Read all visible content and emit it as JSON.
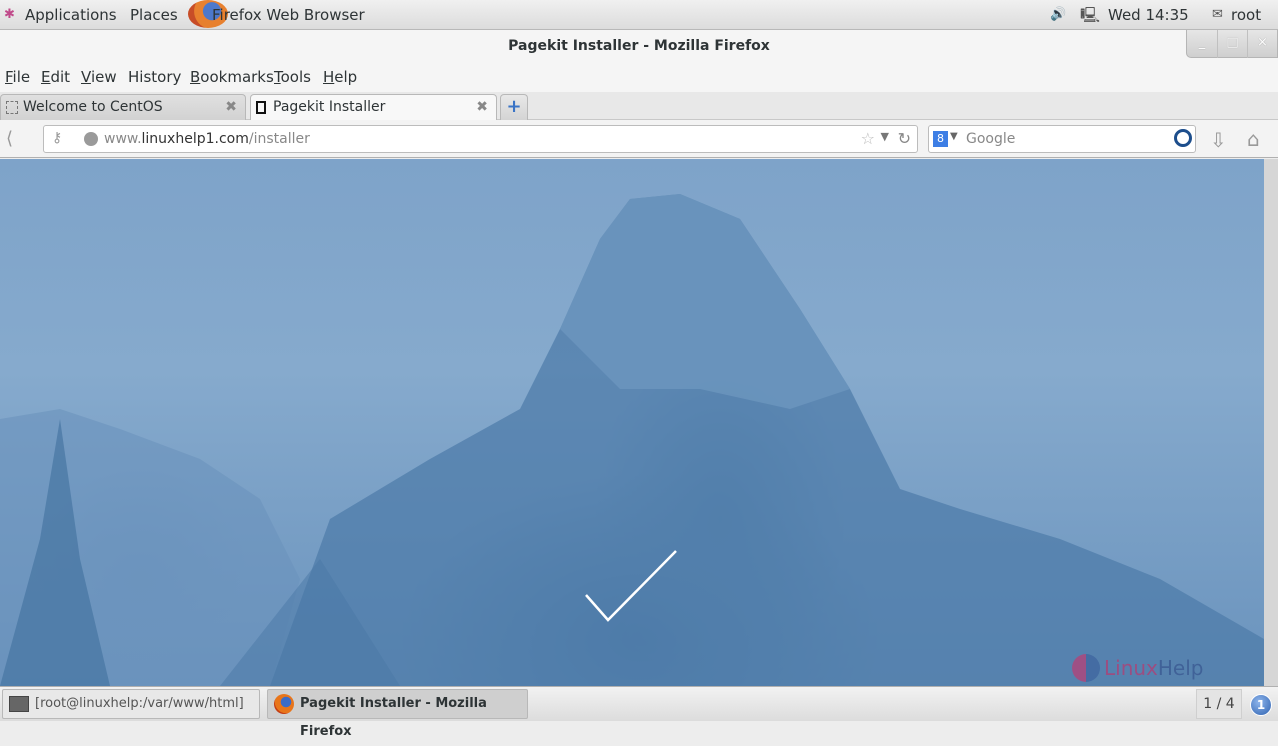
{
  "top_panel": {
    "applications": "Applications",
    "places": "Places",
    "active_app": "Firefox Web Browser",
    "clock": "Wed 14:35",
    "user": "root",
    "icons": [
      "applications-icon",
      "firefox-icon",
      "volume-icon",
      "network-icon",
      "user-icon"
    ]
  },
  "window": {
    "title": "Pagekit Installer - Mozilla Firefox",
    "controls": {
      "minimize": "_",
      "maximize": "□",
      "close": "×"
    }
  },
  "menubar": {
    "items": [
      {
        "label": "File",
        "accel": "F",
        "rest": "ile"
      },
      {
        "label": "Edit",
        "accel": "E",
        "rest": "dit"
      },
      {
        "label": "View",
        "accel": "V",
        "rest": "iew"
      },
      {
        "label": "History",
        "accel": "s"
      },
      {
        "label": "Bookmarks",
        "accel": "B",
        "rest": "ookmarks"
      },
      {
        "label": "Tools",
        "accel": "T",
        "rest": "ools"
      },
      {
        "label": "Help",
        "accel": "H",
        "rest": "elp"
      }
    ]
  },
  "tabs": [
    {
      "label": "Welcome to CentOS",
      "active": false
    },
    {
      "label": "Pagekit Installer",
      "active": true
    }
  ],
  "new_tab_label": "+",
  "navbar": {
    "url_domain_prefix": "www.",
    "url_domain": "linuxhelp1.com",
    "url_path": "/installer",
    "search_placeholder": "Google",
    "search_engine_icon": "8"
  },
  "page": {
    "status_icon": "checkmark-icon",
    "watermark_part1": "Linux",
    "watermark_part2": "Help"
  },
  "taskbar": {
    "tasks": [
      {
        "label": "[root@linuxhelp:/var/www/html]",
        "icon": "terminal-icon",
        "active": false
      },
      {
        "label": "Pagekit Installer - Mozilla Firefox",
        "icon": "firefox-icon",
        "active": true
      }
    ],
    "workspace": "1 / 4",
    "notification_count": "1"
  }
}
